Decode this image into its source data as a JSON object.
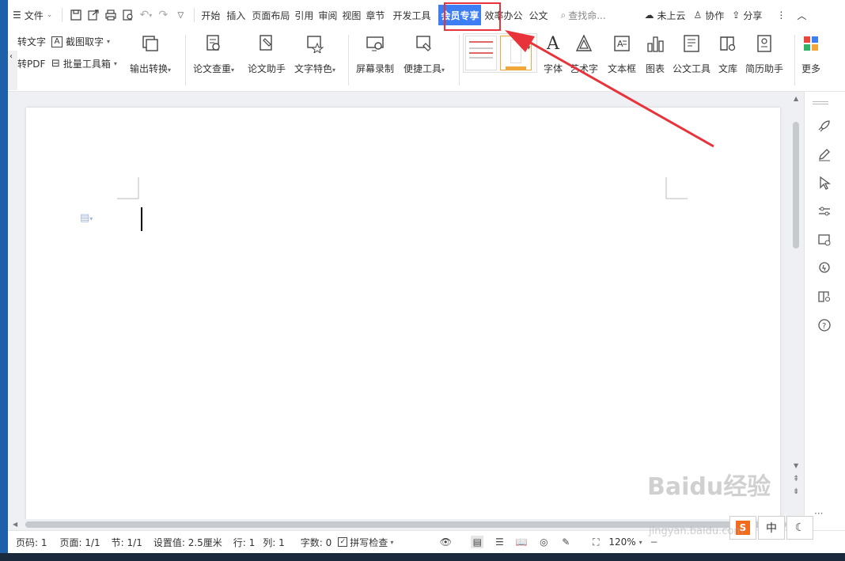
{
  "menubar": {
    "file_label": "文件",
    "tabs": [
      "开始",
      "插入",
      "页面布局",
      "引用",
      "审阅",
      "视图",
      "章节",
      "开发工具",
      "会员专享",
      "效率办公",
      "公文"
    ],
    "active_tab": "会员专享",
    "search_placeholder": "查找命...",
    "cloud_label": "未上云",
    "collab_label": "协作",
    "share_label": "分享"
  },
  "ribbon": {
    "small_items": [
      "转文字",
      "转PDF",
      "截图取字",
      "批量工具箱"
    ],
    "big_items": [
      "输出转换",
      "论文查重",
      "论文助手",
      "文字特色",
      "屏幕录制",
      "便捷工具",
      "字体",
      "艺术字",
      "文本框",
      "图表",
      "公文工具",
      "文库",
      "简历助手",
      "更多"
    ]
  },
  "statusbar": {
    "page_code": "页码: 1",
    "page": "页面: 1/1",
    "section": "节: 1/1",
    "setting": "设置值: 2.5厘米",
    "row": "行: 1",
    "col": "列: 1",
    "word_count": "字数: 0",
    "spellcheck": "拼写检查",
    "zoom": "120%"
  },
  "ime": {
    "mode": "中"
  },
  "watermark": {
    "logo": "Baidu经验",
    "url": "jingyan.baidu.com"
  },
  "colors": {
    "accent": "#3d7ff3",
    "highlight": "#e8333a"
  },
  "icons": [
    "menu-icon",
    "save-icon",
    "export-icon",
    "print-icon",
    "preview-icon",
    "undo-icon",
    "redo-icon",
    "search-icon",
    "cloud-icon",
    "user-icon",
    "share-icon",
    "more-icon",
    "collapse-icon"
  ]
}
